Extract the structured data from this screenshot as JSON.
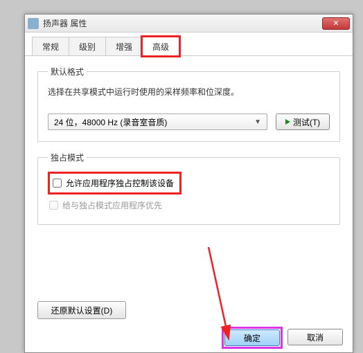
{
  "window": {
    "title": "扬声器 属性"
  },
  "tabs": {
    "general": "常规",
    "levels": "级别",
    "enhance": "增强",
    "advanced": "高级"
  },
  "default_format": {
    "legend": "默认格式",
    "desc": "选择在共享模式中运行时使用的采样频率和位深度。",
    "selected": "24 位，48000 Hz (录音室音质)",
    "test_label": "测试(T)"
  },
  "exclusive": {
    "legend": "独占模式",
    "allow_label": "允许应用程序独占控制该设备",
    "priority_label": "给与独占模式应用程序优先"
  },
  "buttons": {
    "restore": "还原默认设置(D)",
    "ok": "确定",
    "cancel": "取消"
  }
}
